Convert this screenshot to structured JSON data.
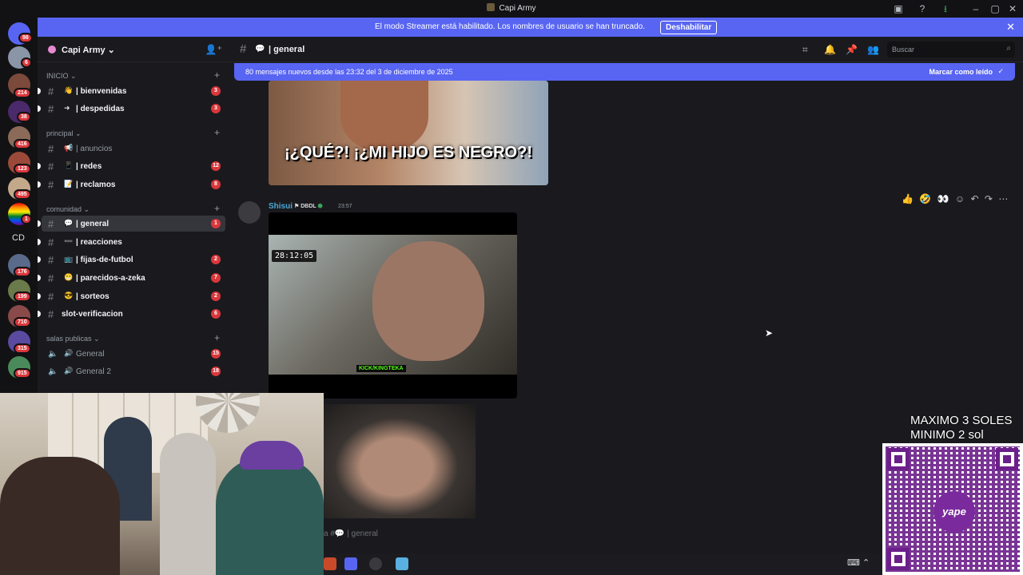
{
  "window": {
    "title": "Capi Army",
    "controls": [
      "minimize",
      "maximize",
      "close"
    ]
  },
  "streamer_banner": {
    "message": "El modo Streamer está habilitado. Los nombres de usuario se han truncado.",
    "button": "Deshabilitar"
  },
  "server_rail": {
    "badges": [
      "98",
      "6",
      "214",
      "38",
      "416",
      "123",
      "495",
      "1",
      "176",
      "199",
      "710",
      "315",
      "915"
    ],
    "folder_label": "CD"
  },
  "guild": {
    "name": "Capi Army",
    "categories": [
      {
        "label": "INICIO",
        "channels": [
          {
            "emoji": "👋",
            "label": "| bienvenidas",
            "count": "3",
            "unread": true
          },
          {
            "emoji": "➜",
            "label": "| despedidas",
            "count": "3",
            "unread": true
          }
        ]
      },
      {
        "label": "principal",
        "channels": [
          {
            "emoji": "📢",
            "label": "| anuncios",
            "count": "",
            "unread": false
          },
          {
            "emoji": "📱",
            "label": "| redes",
            "count": "12",
            "unread": true
          },
          {
            "emoji": "📝",
            "label": "| reclamos",
            "count": "8",
            "unread": true
          }
        ]
      },
      {
        "label": "comunidad",
        "channels": [
          {
            "emoji": "💬",
            "label": "| general",
            "count": "1",
            "unread": true,
            "active": true
          },
          {
            "emoji": "➖",
            "label": "| reacciones",
            "count": "",
            "unread": true
          },
          {
            "emoji": "📺",
            "label": "| fijas-de-futbol",
            "count": "2",
            "unread": true
          },
          {
            "emoji": "😁",
            "label": "| parecidos-a-zeka",
            "count": "7",
            "unread": true
          },
          {
            "emoji": "😎",
            "label": "| sorteos",
            "count": "2",
            "unread": true
          },
          {
            "emoji": "",
            "label": "slot-verificacion",
            "count": "6",
            "unread": true
          }
        ]
      },
      {
        "label": "salas publicas",
        "channels": [
          {
            "emoji": "🔊",
            "label": "General",
            "count": "15",
            "unread": false,
            "voice": true
          },
          {
            "emoji": "🔊",
            "label": "General 2",
            "count": "18",
            "unread": false,
            "voice": true
          }
        ]
      }
    ]
  },
  "channel_header": {
    "name": "| general",
    "icon": "speech-balloon-icon",
    "search_placeholder": "Buscar"
  },
  "new_messages_bar": {
    "text": "80 mensajes nuevos desde las 23:32 del 3 de diciembre de 2025",
    "action": "Marcar como leído"
  },
  "messages": {
    "image_caption": "¡¿QUÉ?! ¡¿MI HIJO ES NEGRO?!",
    "post": {
      "author": "Shisui",
      "tag": "DBDL",
      "time": "23:57",
      "video_timecode": "28:12:05",
      "video_watermark": "KICK/KINGTEKA"
    }
  },
  "composer": {
    "placeholder": "a #💬 | general"
  },
  "promo": {
    "line1": "MAXIMO 3 SOLES",
    "line2": "MINIMO 2 sol",
    "qr_brand": "yape"
  },
  "colors": {
    "accent": "#5865f2",
    "badge": "#da373c",
    "author": "#4aa8d8"
  }
}
